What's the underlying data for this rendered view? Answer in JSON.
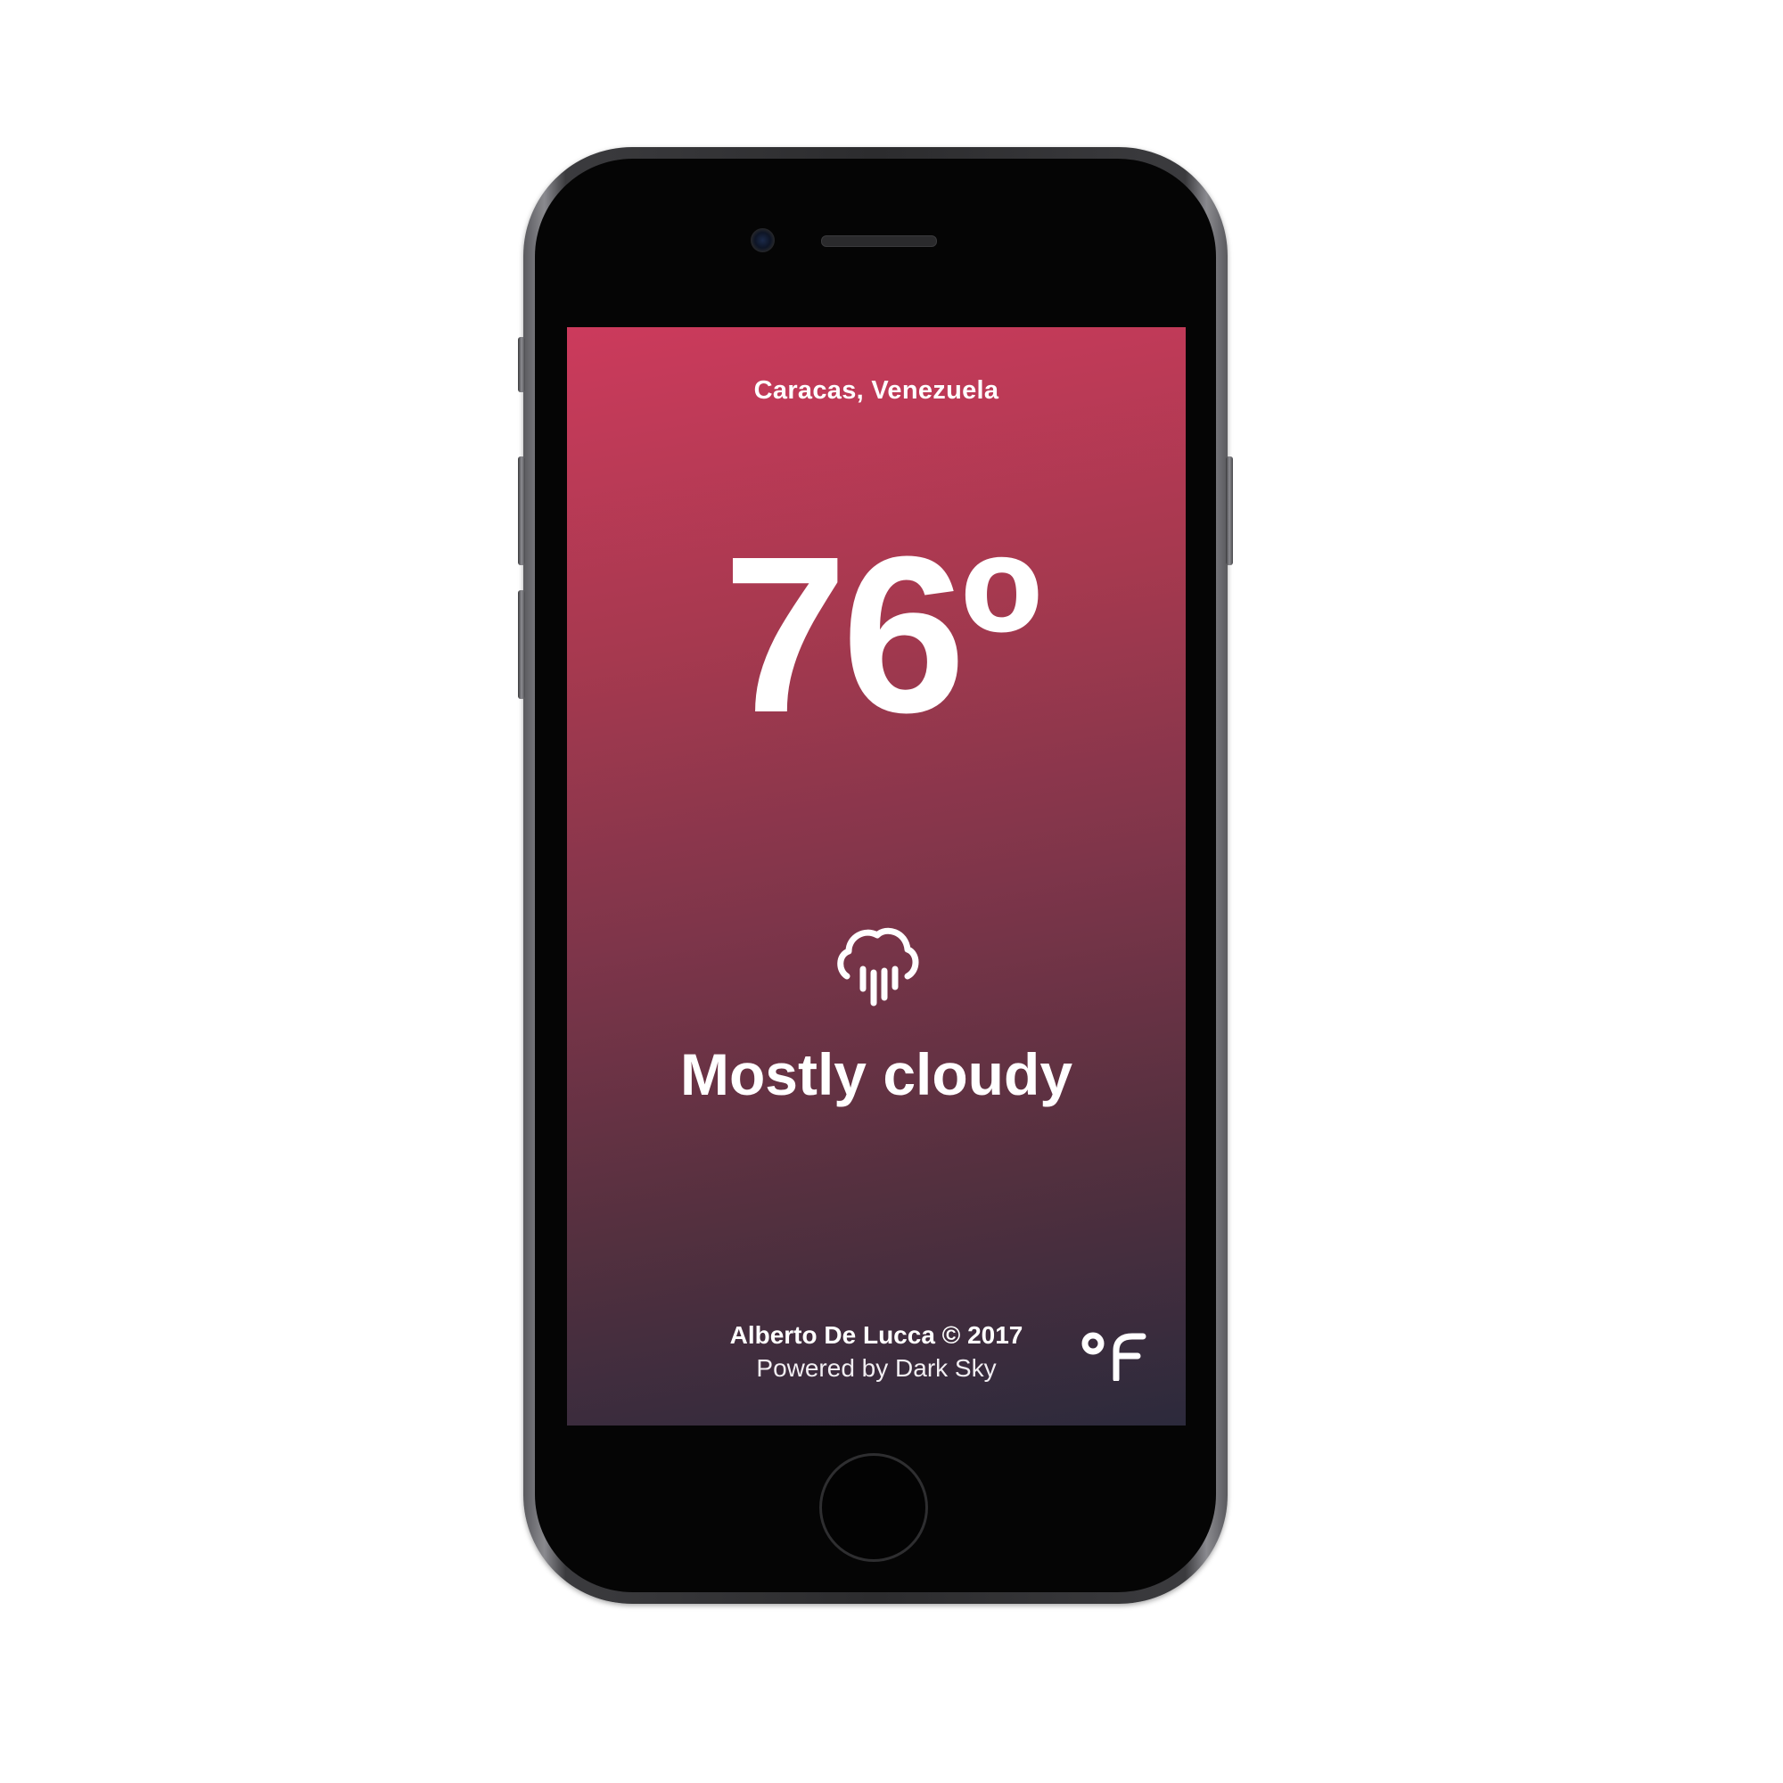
{
  "weather": {
    "location": "Caracas, Venezuela",
    "temperature": "76º",
    "condition": "Mostly cloudy",
    "condition_icon": "rain-cloud-icon"
  },
  "footer": {
    "credit": "Alberto De Lucca © 2017",
    "powered_by": "Powered by Dark Sky",
    "unit_toggle_icon": "fahrenheit-toggle-icon"
  },
  "colors": {
    "gradient_top": "#cc3a5c",
    "gradient_mid": "#7e354a",
    "gradient_bottom": "#2c2a3c",
    "text": "#ffffff"
  }
}
